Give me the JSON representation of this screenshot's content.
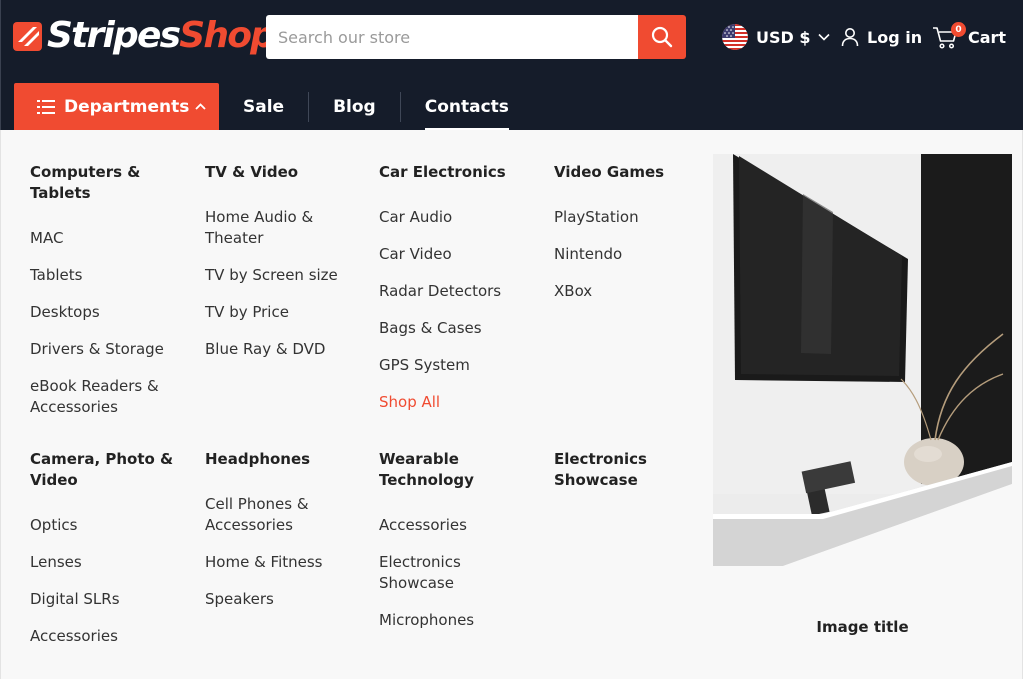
{
  "brand": {
    "part1": "Stripes",
    "part2": "Shop"
  },
  "search": {
    "placeholder": "Search our store"
  },
  "currency": {
    "label": "USD $"
  },
  "account": {
    "login_label": "Log in"
  },
  "cart": {
    "label": "Cart",
    "count": "0"
  },
  "nav": {
    "departments_label": "Departments",
    "links": [
      "Sale",
      "Blog",
      "Contacts"
    ]
  },
  "mega_menu": {
    "row1": [
      {
        "title": "Computers & Tablets",
        "items": [
          "MAC",
          "Tablets",
          "Desktops",
          "Drivers & Storage",
          "eBook Readers & Accessories"
        ]
      },
      {
        "title": "TV & Video",
        "items": [
          "Home Audio & Theater",
          "TV by Screen size",
          "TV by Price",
          "Blue Ray & DVD"
        ]
      },
      {
        "title": "Car Electronics",
        "items": [
          "Car Audio",
          "Car Video",
          "Radar Detectors",
          "Bags & Cases",
          "GPS System",
          "Shop All"
        ]
      },
      {
        "title": "Video Games",
        "items": [
          "PlayStation",
          "Nintendo",
          "XBox"
        ]
      }
    ],
    "row2": [
      {
        "title": "Camera, Photo & Video",
        "items": [
          "Optics",
          "Lenses",
          "Digital SLRs",
          "Accessories"
        ]
      },
      {
        "title": "Headphones",
        "items": [
          "Cell Phones & Accessories",
          "Home & Fitness",
          "Speakers"
        ]
      },
      {
        "title": "Wearable Technology",
        "items": [
          "Accessories",
          "Electronics Showcase",
          "Microphones"
        ]
      },
      {
        "title": "Electronics Showcase",
        "items": []
      }
    ],
    "promo": {
      "caption": "Image title"
    }
  },
  "colors": {
    "accent": "#f04b31",
    "header_bg": "#151c2a",
    "panel_bg": "#f8f8f8"
  },
  "icons": [
    "logo-mark-icon",
    "search-icon",
    "us-flag-icon",
    "chevron-down-icon",
    "user-icon",
    "cart-icon",
    "list-icon",
    "chevron-up-icon"
  ]
}
